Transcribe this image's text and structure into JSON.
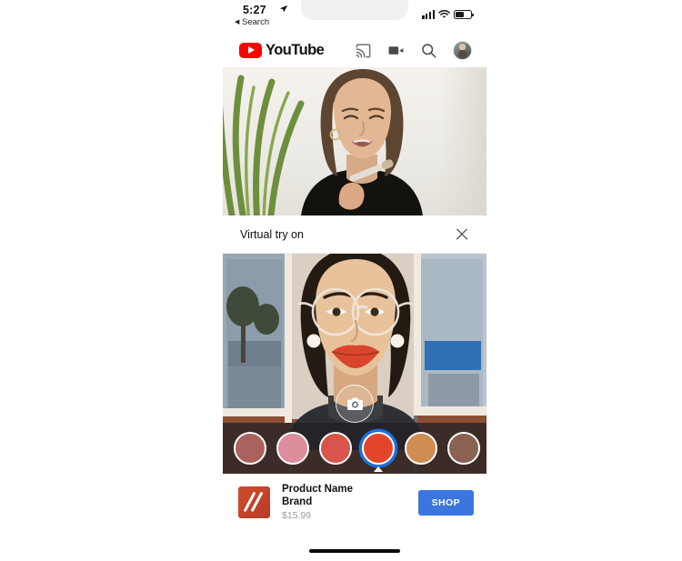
{
  "status_bar": {
    "time": "5:27",
    "location_icon": "location-arrow-icon",
    "back_label": "Search",
    "back_caret": "◀",
    "signal_icon": "cellular-signal-icon",
    "wifi_icon": "wifi-icon",
    "battery_icon": "battery-icon"
  },
  "app_header": {
    "brand": "YouTube",
    "logo_icon": "youtube-play-logo-icon",
    "actions": [
      {
        "name": "cast-icon"
      },
      {
        "name": "video-camera-icon"
      },
      {
        "name": "search-icon"
      },
      {
        "name": "account-avatar"
      }
    ]
  },
  "video": {
    "description_icon": "video-thumbnail"
  },
  "tryon_bar": {
    "title": "Virtual try on",
    "close_icon": "close-icon"
  },
  "ar_view": {
    "shutter_icon": "camera-shutter-icon",
    "selected_index": 3,
    "swatches": [
      {
        "name": "swatch-mauve",
        "color": "#a9625e"
      },
      {
        "name": "swatch-pink",
        "color": "#dd8d9c"
      },
      {
        "name": "swatch-coral",
        "color": "#d9544a"
      },
      {
        "name": "swatch-red-orange",
        "color": "#e2452a"
      },
      {
        "name": "swatch-tan-orange",
        "color": "#cf8d52"
      },
      {
        "name": "swatch-brown",
        "color": "#8a6252"
      }
    ]
  },
  "product": {
    "thumb_icon": "lipstick-swatch-thumbnail",
    "name": "Product Name",
    "brand": "Brand",
    "price": "$15.99",
    "shop_label": "SHOP"
  },
  "bottom": {
    "home_indicator": "home-indicator"
  },
  "colors": {
    "brand_red": "#ff0000",
    "shop_blue": "#3b76e0",
    "selection_ring": "#1f6fe0",
    "strip_overlay": "rgba(32,33,36,.74)"
  }
}
